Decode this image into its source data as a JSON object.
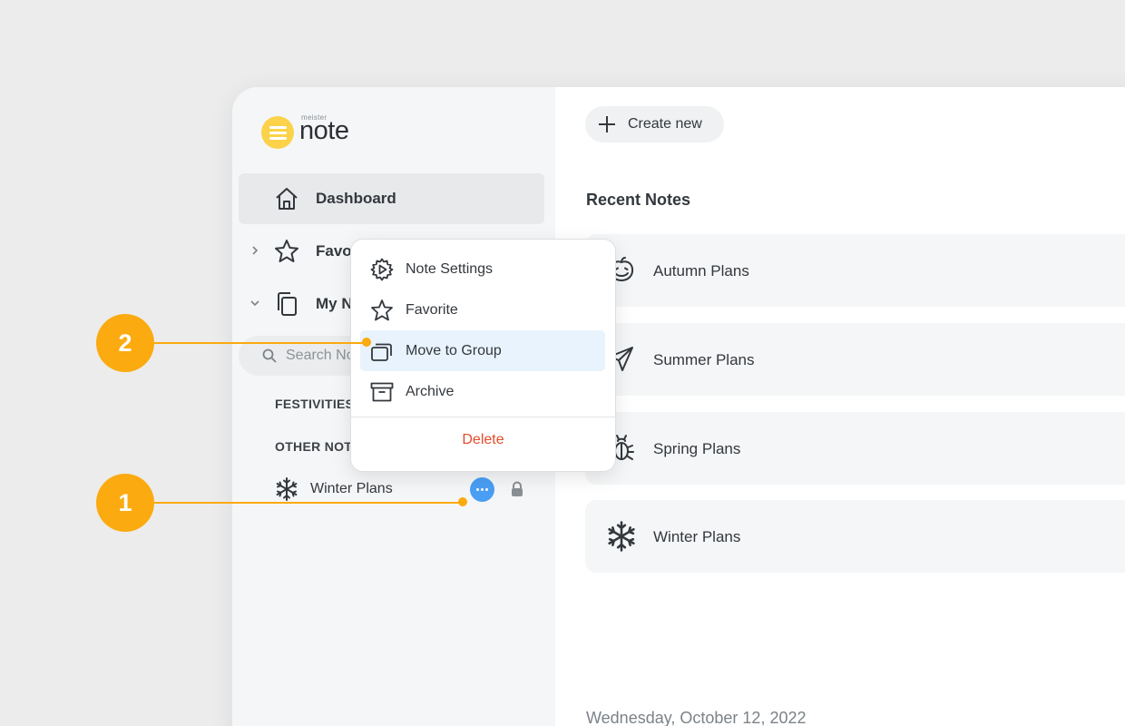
{
  "brand": {
    "small": "meister",
    "name": "note",
    "color": "#fbd24a"
  },
  "sidebar": {
    "nav": [
      {
        "label": "Dashboard",
        "icon": "home-icon",
        "active": true
      },
      {
        "label": "Favo",
        "icon": "star-icon",
        "chevron": "chevron-right-icon"
      },
      {
        "label": "My N",
        "icon": "notes-icon",
        "chevron": "chevron-down-icon"
      }
    ],
    "search_placeholder": "Search No",
    "sections": [
      "FESTIVITIES",
      "OTHER NOT"
    ],
    "note": {
      "label": "Winter Plans",
      "icon": "snowflake-icon"
    }
  },
  "main": {
    "create_label": "Create new",
    "recent_title": "Recent Notes",
    "cards": [
      {
        "label": "Autumn Plans",
        "icon": "pumpkin-icon"
      },
      {
        "label": "Summer Plans",
        "icon": "airplane-icon"
      },
      {
        "label": "Spring Plans",
        "icon": "bug-icon"
      },
      {
        "label": "Winter Plans",
        "icon": "snowflake-icon"
      }
    ],
    "date": "Wednesday, October 12, 2022"
  },
  "menu": {
    "items": [
      {
        "label": "Note Settings",
        "icon": "settings-gear-icon"
      },
      {
        "label": "Favorite",
        "icon": "star-icon"
      },
      {
        "label": "Move to Group",
        "icon": "move-group-icon",
        "highlighted": true
      },
      {
        "label": "Archive",
        "icon": "archive-icon"
      }
    ],
    "delete_label": "Delete",
    "delete_color": "#e44b2b"
  },
  "annotations": [
    "1",
    "2"
  ],
  "colors": {
    "accent": "#4a9ef3",
    "annotation": "#fbaa0f",
    "highlight": "#e8f3fd"
  }
}
